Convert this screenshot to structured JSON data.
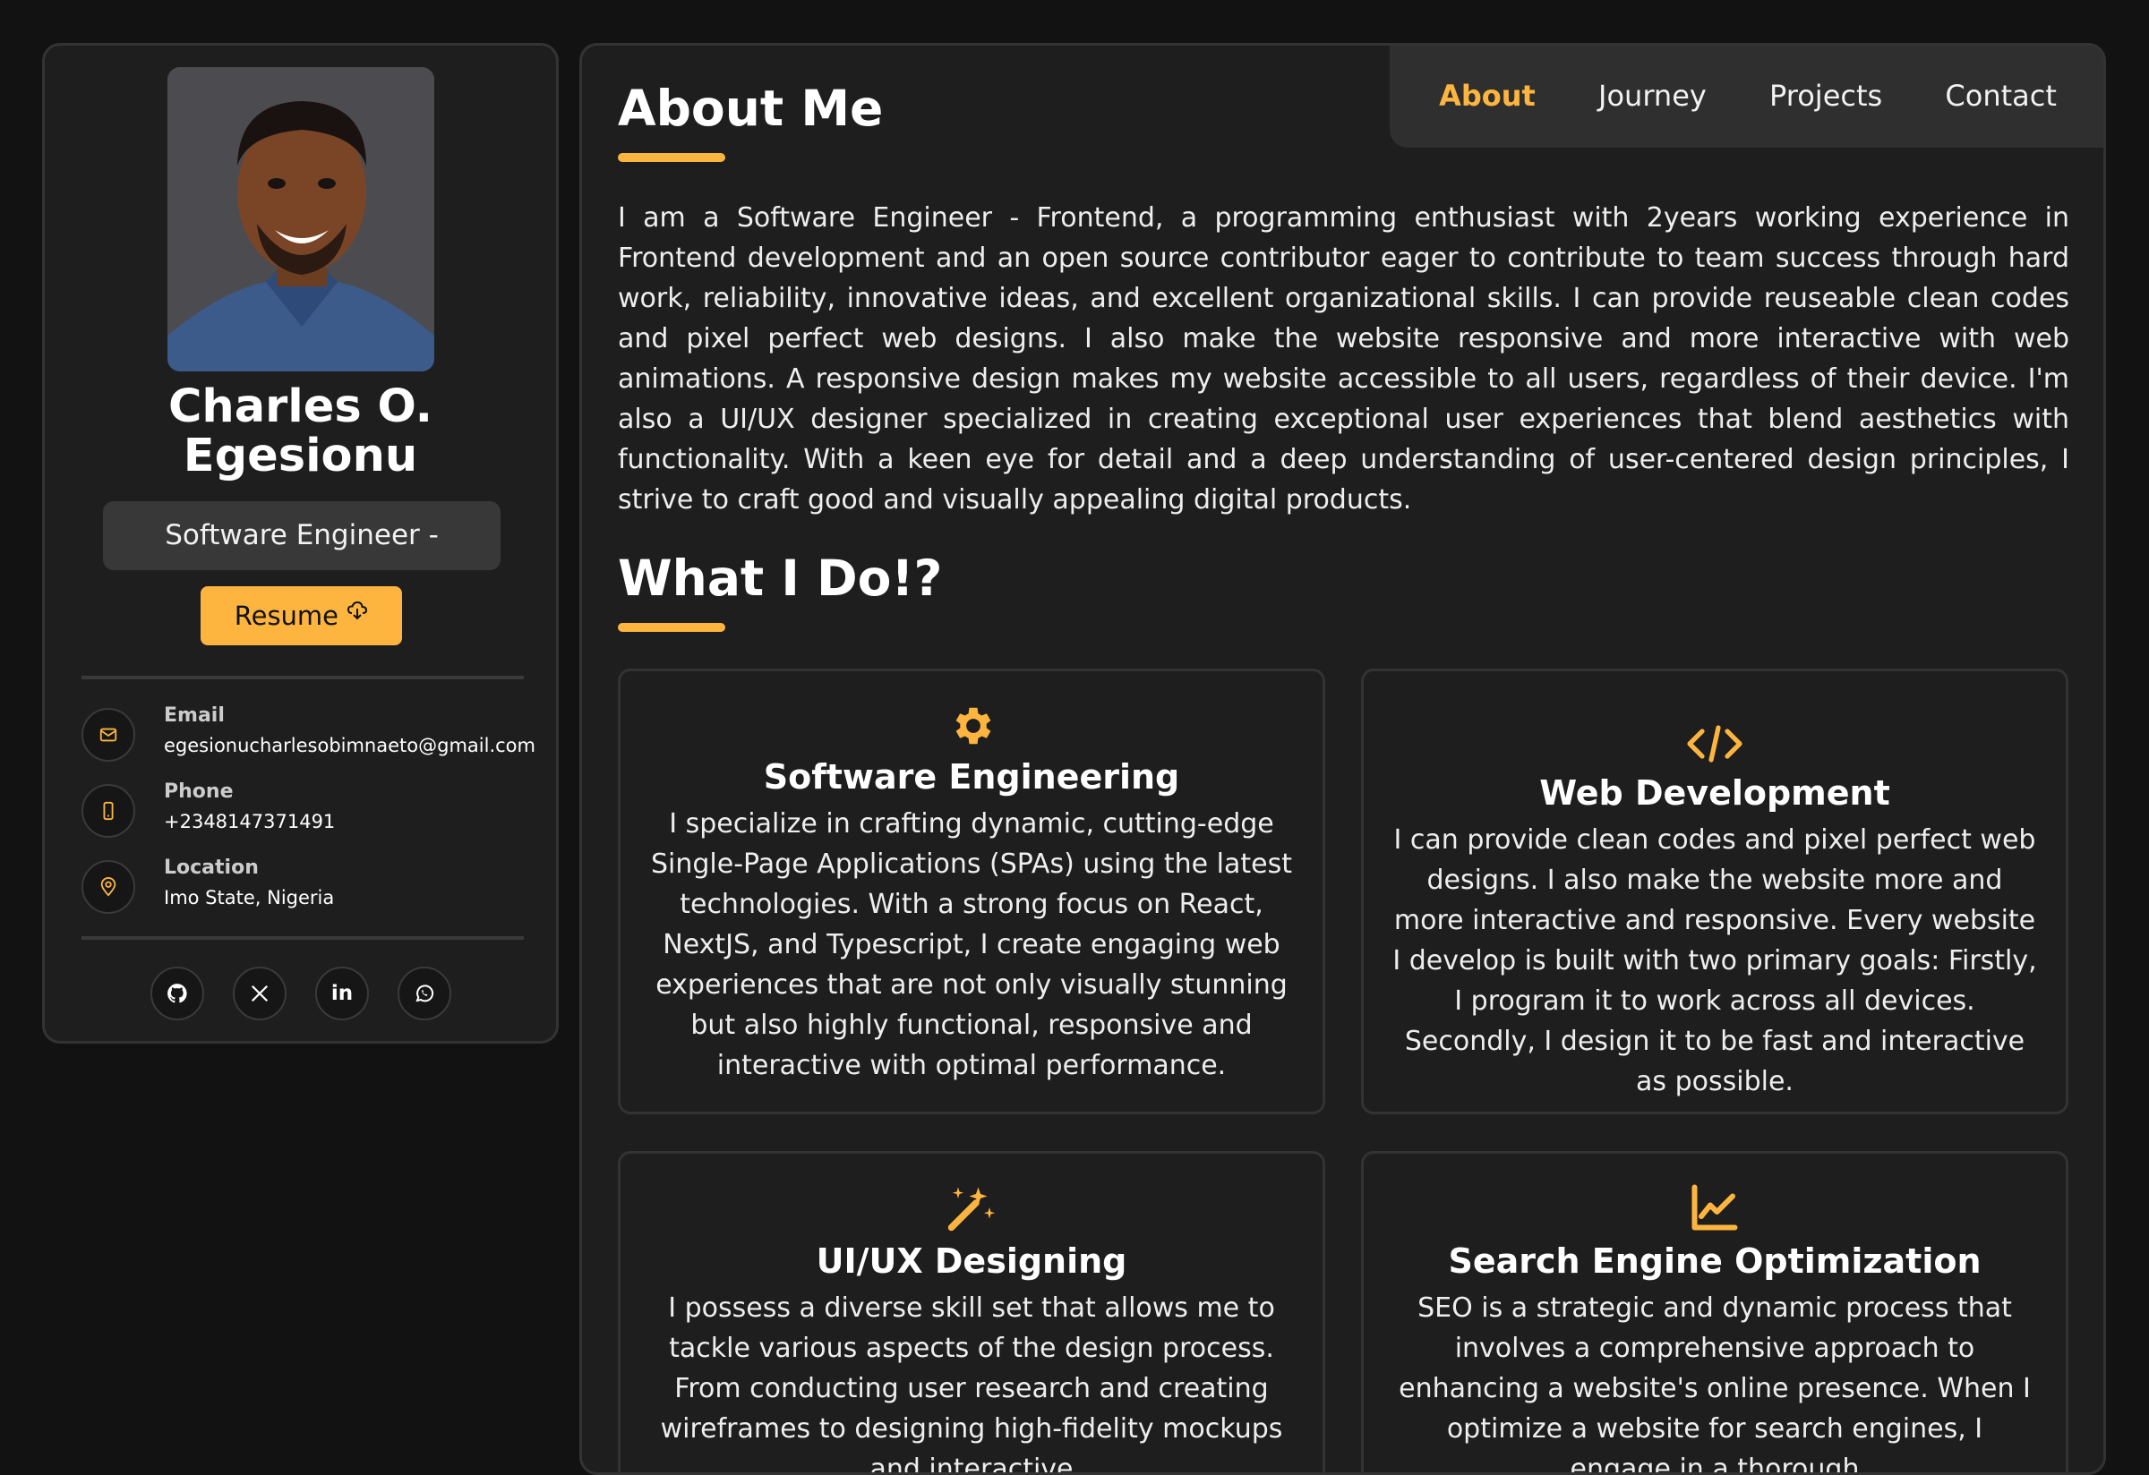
{
  "profile": {
    "name_line1": "Charles O.",
    "name_line2": "Egesionu",
    "role": "Software Engineer - Frontend",
    "resume_label": "Resume",
    "contacts": [
      {
        "label": "Email",
        "value": "egesionucharlesobimnaeto@gmail.com",
        "icon": "mail-icon"
      },
      {
        "label": "Phone",
        "value": "+2348147371491",
        "icon": "phone-icon"
      },
      {
        "label": "Location",
        "value": "Imo State, Nigeria",
        "icon": "location-pin-icon"
      }
    ],
    "socials": [
      "github-icon",
      "x-twitter-icon",
      "linkedin-icon",
      "whatsapp-icon"
    ]
  },
  "nav": {
    "items": [
      "About",
      "Journey",
      "Projects",
      "Contact"
    ],
    "active": "About"
  },
  "about": {
    "title": "About Me",
    "text": "I am a Software Engineer - Frontend, a programming enthusiast with 2years working experience in Frontend development and an open source contributor eager to contribute to team success through hard work, reliability, innovative ideas, and excellent organizational skills. I can provide reuseable clean codes and pixel perfect web designs. I also make the website responsive and more interactive with web animations. A responsive design makes my website accessible to all users, regardless of their device. I'm also a UI/UX designer specialized in creating exceptional user experiences that blend aesthetics with functionality. With a keen eye for detail and a deep understanding of user-centered design principles, I strive to craft good and visually appealing digital products."
  },
  "services": {
    "title": "What I Do!?",
    "cards": [
      {
        "title": "Software Engineering",
        "icon": "gear-icon",
        "text": "I specialize in crafting dynamic, cutting-edge Single-Page Applications (SPAs) using the latest technologies. With a strong focus on React, NextJS, and Typescript, I create engaging web experiences that are not only visually stunning but also highly functional, responsive and interactive with optimal performance."
      },
      {
        "title": "Web Development",
        "icon": "code-icon",
        "text": "I can provide clean codes and pixel perfect web designs. I also make the website more and more interactive and responsive. Every website I develop is built with two primary goals: Firstly, I program it to work across all devices. Secondly, I design it to be fast and interactive as possible."
      },
      {
        "title": "UI/UX Designing",
        "icon": "magic-wand-icon",
        "text": "I possess a diverse skill set that allows me to tackle various aspects of the design process. From conducting user research and creating wireframes to designing high-fidelity mockups and interactive"
      },
      {
        "title": "Search Engine Optimization",
        "icon": "chart-line-icon",
        "text": "SEO is a strategic and dynamic process that involves a comprehensive approach to enhancing a website's online presence. When I optimize a website for search engines, I engage in a thorough"
      }
    ]
  },
  "colors": {
    "accent": "#fdb53f",
    "background": "#121212",
    "panel": "#1e1e1e"
  }
}
